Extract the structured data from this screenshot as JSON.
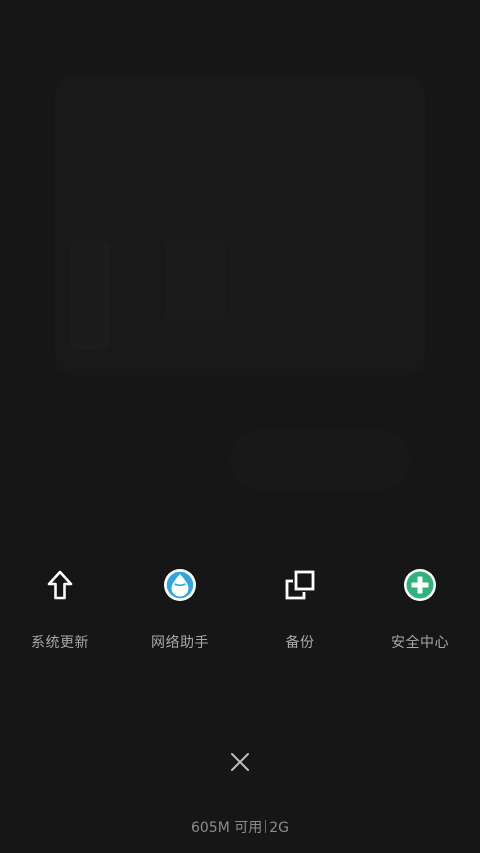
{
  "shortcuts": [
    {
      "label": "系统更新",
      "icon": "arrow-up-icon"
    },
    {
      "label": "网络助手",
      "icon": "water-drop-icon",
      "color": "#2ea6df"
    },
    {
      "label": "备份",
      "icon": "backup-icon"
    },
    {
      "label": "安全中心",
      "icon": "plus-circle-icon",
      "color": "#2fb37a"
    }
  ],
  "close": {
    "icon": "close-icon"
  },
  "memory": {
    "available": "605M 可用",
    "total": "2G"
  }
}
